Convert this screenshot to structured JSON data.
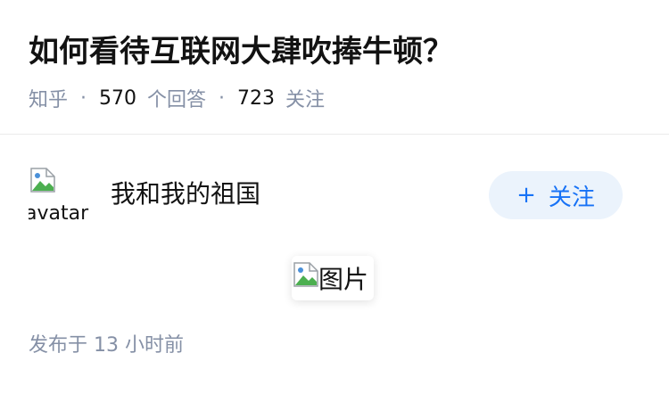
{
  "question": {
    "title": "如何看待互联网大肆吹捧牛顿？",
    "meta_source": "知乎",
    "separator": "·",
    "answer_count": "570",
    "answer_label": "个回答",
    "follower_count": "723",
    "follower_label": "关注"
  },
  "answer": {
    "avatar_alt": "avatar",
    "author_name": "我和我的祖国",
    "follow_button_plus": "+",
    "follow_button_label": "关注",
    "image_alt": "图片",
    "publish_time": "发布于 13 小时前"
  },
  "colors": {
    "title_text": "#121212",
    "meta_text": "#8590a6",
    "follow_button_bg": "#ebf3fc",
    "follow_button_text": "#1772f6",
    "divider": "#ebebeb"
  },
  "icons": {
    "broken_image": "broken-image-icon"
  }
}
